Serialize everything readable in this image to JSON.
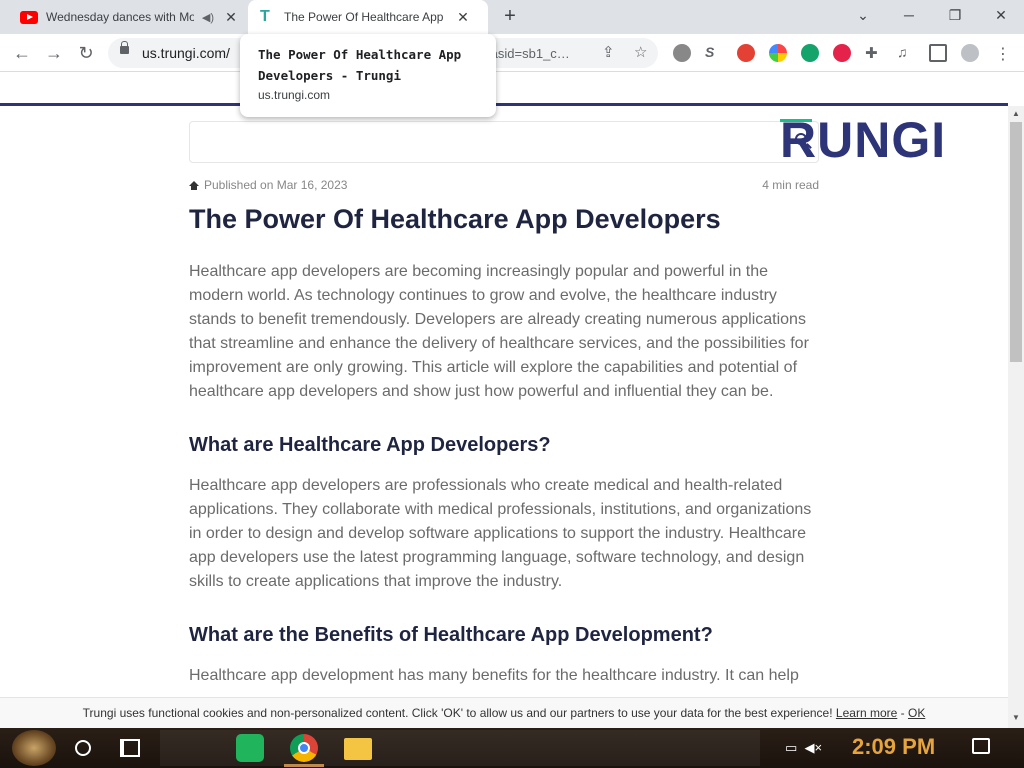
{
  "browser": {
    "tabs": [
      {
        "title": "Wednesday dances with Mo",
        "icon": "youtube-icon"
      },
      {
        "title": "The Power Of Healthcare App",
        "icon": "trungi-icon"
      }
    ],
    "window_controls": {
      "minimize": "─",
      "maximize": "❐",
      "close": "✕",
      "dropdown": "⌄"
    },
    "new_tab": "+",
    "url": "us.trungi.com/",
    "url_tail": "&asid=sb1_c…",
    "hover_card": {
      "title": "The Power Of Healthcare App Developers - Trungi",
      "domain": "us.trungi.com"
    }
  },
  "site": {
    "logo_text": "RUNGI",
    "accent_color": "#2d3478",
    "green_accent": "#16c08b"
  },
  "article": {
    "published": "Published on Mar 16, 2023",
    "read_time": "4 min read",
    "title": "The Power Of Healthcare App Developers",
    "intro": "Healthcare app developers are becoming increasingly popular and powerful in the modern world. As technology continues to grow and evolve, the healthcare industry stands to benefit tremendously. Developers are already creating numerous applications that streamline and enhance the delivery of healthcare services, and the possibilities for improvement are only growing. This article will explore the capabilities and potential of healthcare app developers and show just how powerful and influential they can be.",
    "h2_1": "What are Healthcare App Developers?",
    "p2": "Healthcare app developers are professionals who create medical and health-related applications. They collaborate with medical professionals, institutions, and organizations in order to design and develop software applications to support the industry. Healthcare app developers use the latest programming language, software technology, and design skills to create applications that improve the industry.",
    "h2_2": "What are the Benefits of Healthcare App Development?",
    "p3": "Healthcare app development has many benefits for the healthcare industry. It can help"
  },
  "cookie": {
    "text": "Trungi uses functional cookies and non-personalized content. Click 'OK' to allow us and our partners to use your data for the best experience!",
    "learn_more": "Learn more",
    "separator": "-",
    "ok": "OK"
  },
  "taskbar": {
    "time": "2:09 PM"
  }
}
